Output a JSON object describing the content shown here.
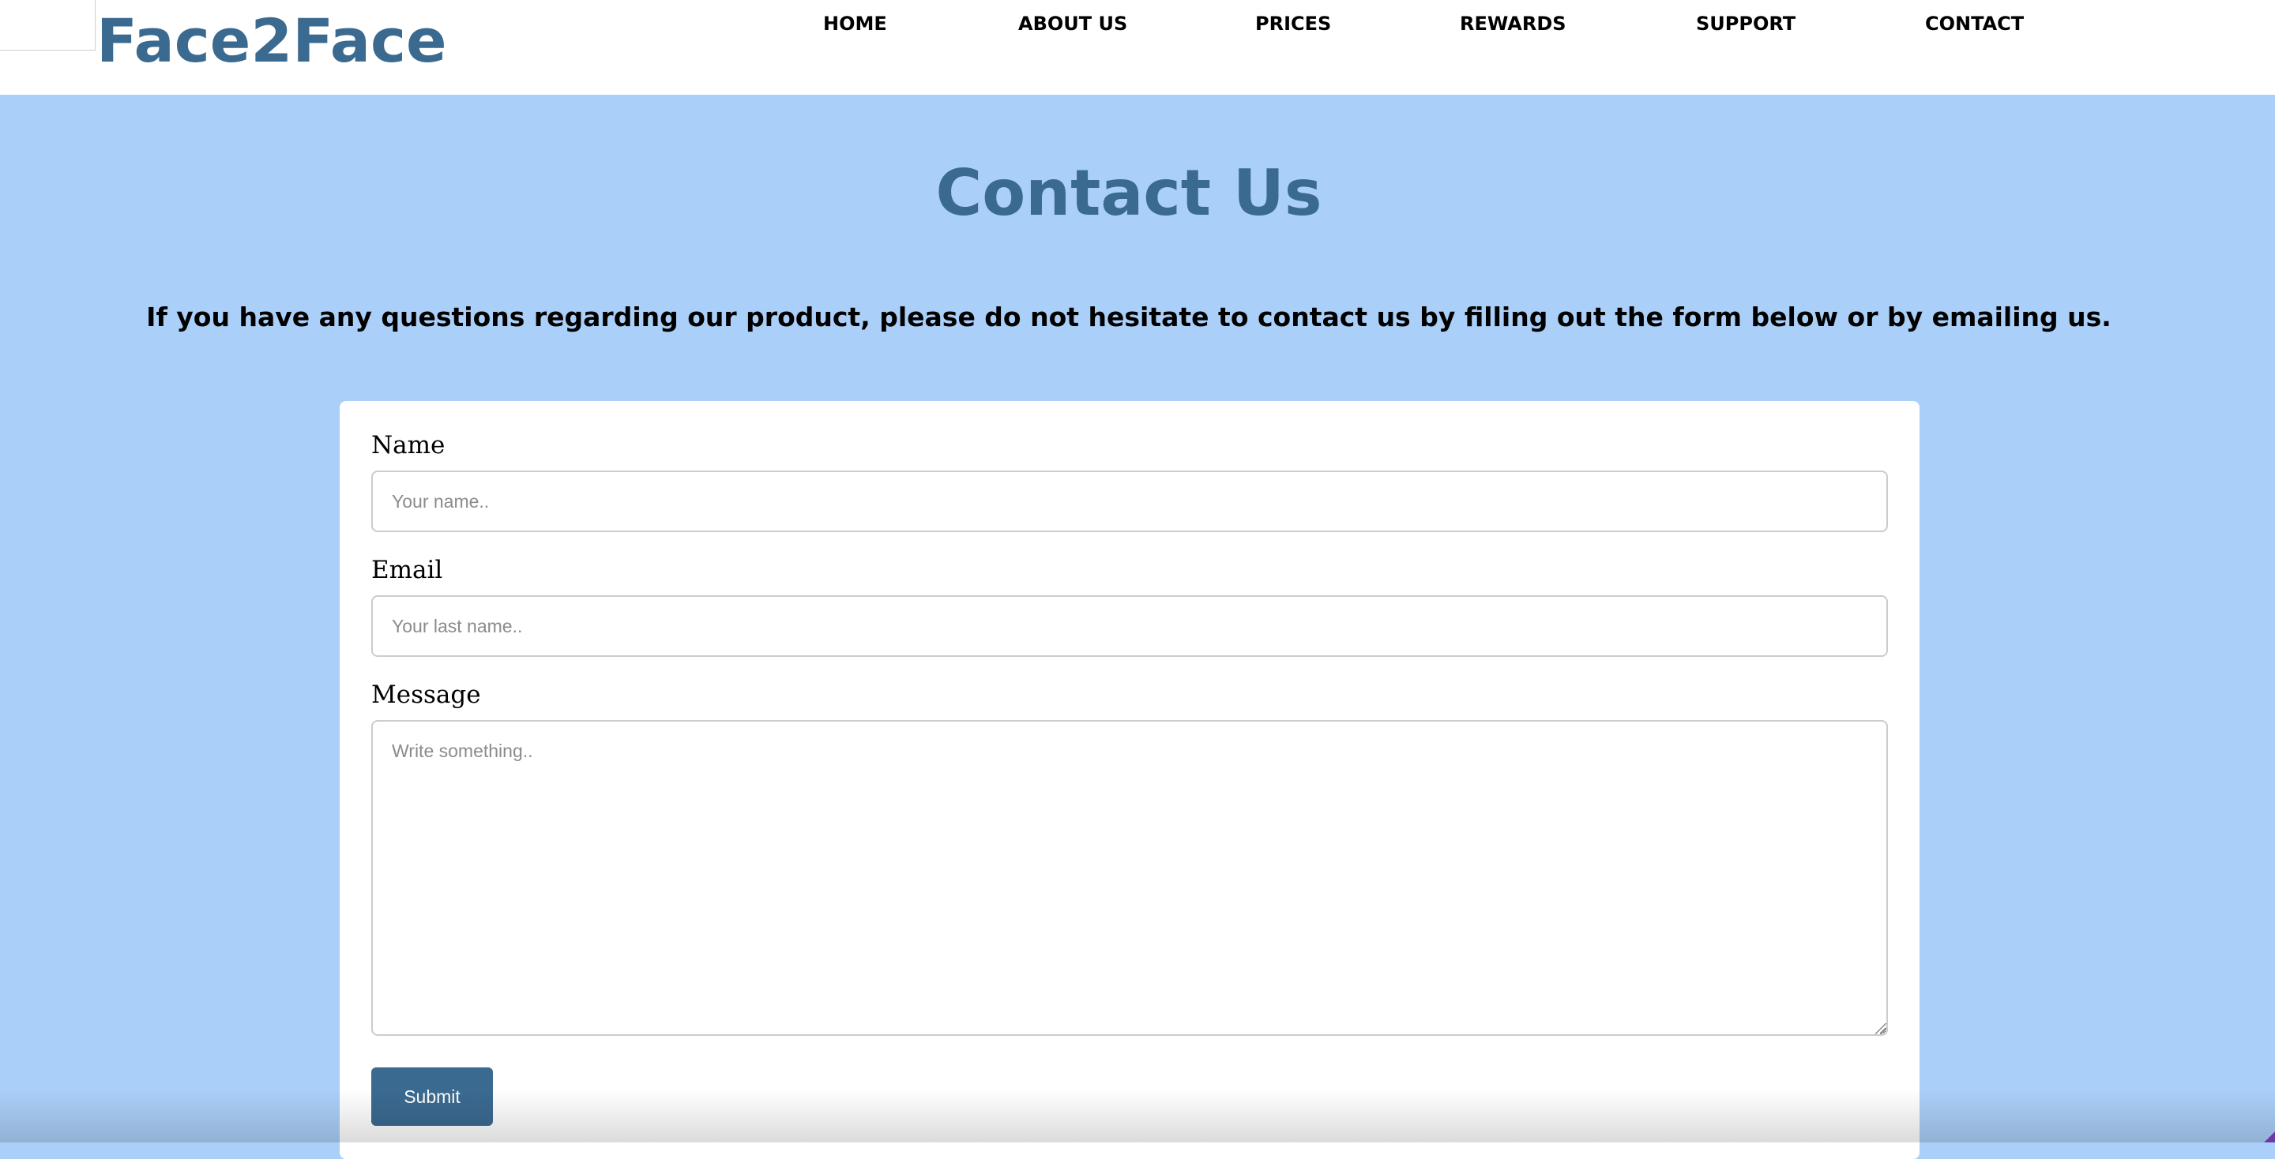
{
  "brand": {
    "logo_text": "Face2Face",
    "logo_color": "#3b6a90",
    "page_background": "#aacff8"
  },
  "nav": {
    "items": [
      {
        "label": "HOME"
      },
      {
        "label": "ABOUT US"
      },
      {
        "label": "PRICES"
      },
      {
        "label": "REWARDS"
      },
      {
        "label": "SUPPORT"
      },
      {
        "label": "CONTACT"
      }
    ]
  },
  "hero": {
    "title": "Contact Us",
    "intro": "If you have any questions regarding our product, please do not hesitate to contact us by filling out the form below or by emailing us."
  },
  "form": {
    "name_label": "Name",
    "name_placeholder": "Your name..",
    "email_label": "Email",
    "email_placeholder": "Your last name..",
    "message_label": "Message",
    "message_placeholder": "Write something..",
    "submit_label": "Submit",
    "submit_color": "#3b6a90"
  }
}
